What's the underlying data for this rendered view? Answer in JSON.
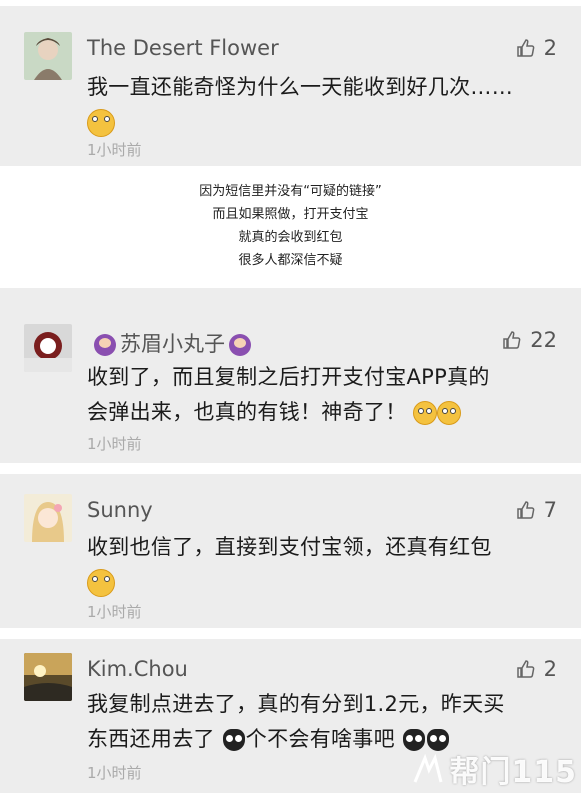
{
  "comments": [
    {
      "name": "The Desert Flower",
      "likes": "2",
      "text": "我一直还能奇怪为什么一天能收到好几次……",
      "time": "1小时前"
    },
    {
      "name": "苏眉小丸子",
      "likes": "22",
      "text_line1": "收到了，而且复制之后打开支付宝APP真的",
      "text_line2": "会弹出来，也真的有钱！神奇了！",
      "time": "1小时前"
    },
    {
      "name": "Sunny",
      "likes": "7",
      "text": "收到也信了，直接到支付宝领，还真有红包",
      "time": "1小时前"
    },
    {
      "name": "Kim.Chou",
      "likes": "2",
      "text_line1": "我复制点进去了，真的有分到1.2元，昨天买",
      "text_line2_a": "东西还用去了",
      "text_line2_b": "个不会有啥事吧",
      "time": "1小时前"
    }
  ],
  "middle_text": [
    "因为短信里并没有“可疑的链接”",
    "而且如果照做，打开支付宝",
    "就真的会收到红包",
    "很多人都深信不疑"
  ],
  "watermark": "帮门115",
  "colors": {
    "card_bg": "#ededed",
    "name": "#555555",
    "time": "#aaaaaa"
  },
  "icons": [
    "thumbs-up-icon",
    "emoji-icon",
    "owl-emoji-icon",
    "girl-emoji-icon"
  ]
}
